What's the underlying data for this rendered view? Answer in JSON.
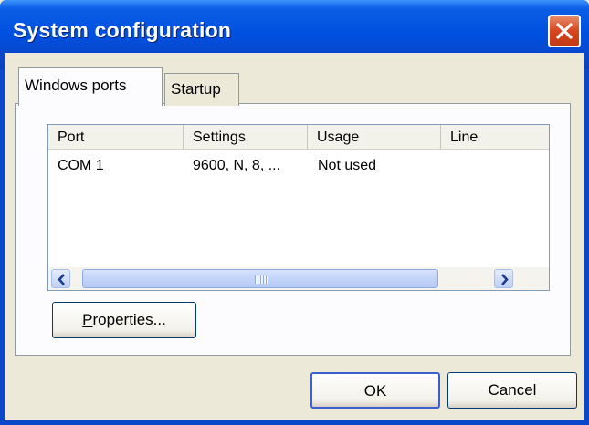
{
  "window": {
    "title": "System configuration",
    "close_icon": "close-x-icon"
  },
  "tabs": [
    {
      "label": "Windows ports",
      "active": true
    },
    {
      "label": "Startup",
      "active": false
    }
  ],
  "list": {
    "columns": [
      "Port",
      "Settings",
      "Usage",
      "Line"
    ],
    "rows": [
      {
        "port": "COM 1",
        "settings": "9600, N, 8, ...",
        "usage": "Not used",
        "line": ""
      }
    ],
    "scrollbar": {
      "left_icon": "scroll-left-arrow-icon",
      "right_icon": "scroll-right-arrow-icon"
    }
  },
  "buttons": {
    "properties_underlined": "P",
    "properties_rest": "roperties...",
    "ok": "OK",
    "cancel": "Cancel"
  },
  "colors": {
    "titlebar": "#0a4fdc",
    "close": "#d5461f",
    "face": "#ece9d8"
  }
}
